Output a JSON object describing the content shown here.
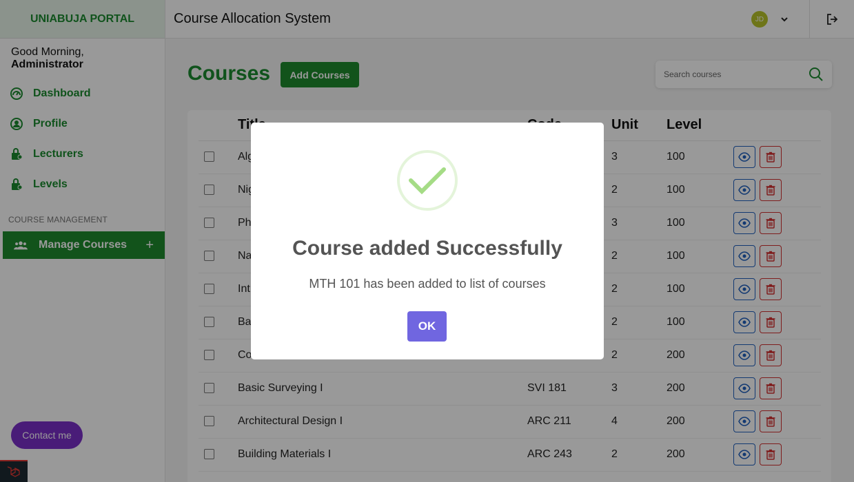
{
  "brand": "UNIABUJA PORTAL",
  "greeting": {
    "prefix": "Good Morning,",
    "name": "Administrator"
  },
  "nav": [
    {
      "label": "Dashboard",
      "icon": "dashboard-icon"
    },
    {
      "label": "Profile",
      "icon": "profile-icon"
    },
    {
      "label": "Lecturers",
      "icon": "lecturers-icon"
    },
    {
      "label": "Levels",
      "icon": "levels-icon"
    }
  ],
  "section_label": "COURSE MANAGEMENT",
  "manage_courses": {
    "label": "Manage Courses",
    "plus": "+"
  },
  "contact_label": "Contact me",
  "header": {
    "title": "Course Allocation System",
    "avatar_initials": "JD"
  },
  "main": {
    "page_title": "Courses",
    "add_button": "Add Courses",
    "search_placeholder": "Search courses"
  },
  "table": {
    "headers": {
      "title": "Title",
      "code": "Code",
      "unit": "Unit",
      "level": "Level"
    },
    "rows": [
      {
        "title": "Algebra",
        "code": "",
        "unit": "3",
        "level": "100"
      },
      {
        "title": "Nigerian",
        "code": "",
        "unit": "2",
        "level": "100"
      },
      {
        "title": "Physics",
        "code": "",
        "unit": "3",
        "level": "100"
      },
      {
        "title": "Na",
        "code": "",
        "unit": "2",
        "level": "100"
      },
      {
        "title": "Int",
        "code": "",
        "unit": "2",
        "level": "100"
      },
      {
        "title": "Ba",
        "code": "",
        "unit": "2",
        "level": "100"
      },
      {
        "title": "Co",
        "code": "",
        "unit": "2",
        "level": "200"
      },
      {
        "title": "Basic Surveying I",
        "code": "SVI 181",
        "unit": "3",
        "level": "200"
      },
      {
        "title": "Architectural Design I",
        "code": "ARC 211",
        "unit": "4",
        "level": "200"
      },
      {
        "title": "Building Materials I",
        "code": "ARC 243",
        "unit": "2",
        "level": "200"
      }
    ]
  },
  "modal": {
    "title": "Course added Successfully",
    "text": "MTH 101 has been added to list of courses",
    "ok_label": "OK"
  },
  "colors": {
    "primary_green": "#1e8a2e",
    "modal_button": "#7066e0",
    "contact_purple": "#7b2fc9"
  }
}
